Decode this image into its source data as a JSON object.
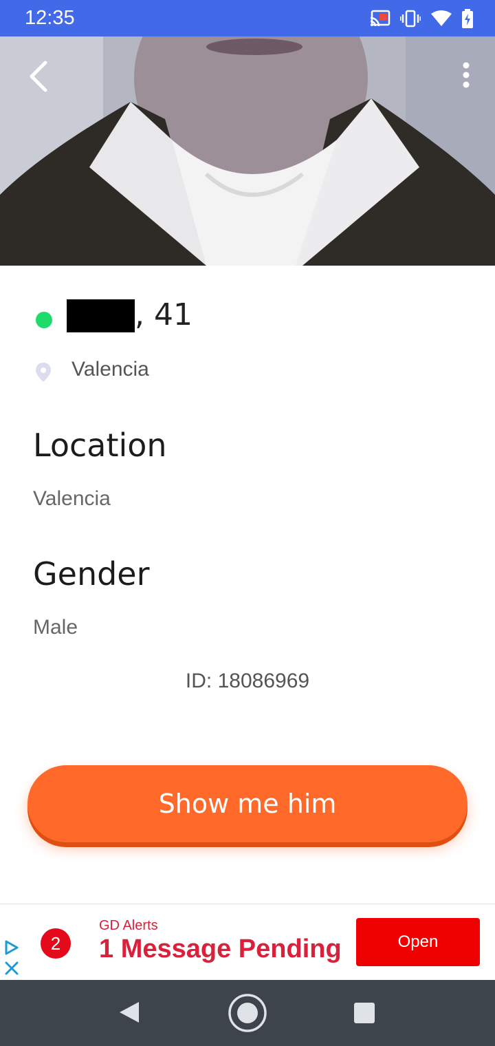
{
  "status_bar": {
    "time": "12:35",
    "icons": [
      "cast-icon",
      "vibrate-icon",
      "wifi-icon",
      "battery-charging-icon"
    ],
    "background": "#4169E8"
  },
  "profile": {
    "online": true,
    "name_redacted": true,
    "age_suffix": ", 41",
    "city": "Valencia"
  },
  "sections": [
    {
      "title": "Location",
      "value": "Valencia"
    },
    {
      "title": "Gender",
      "value": "Male"
    }
  ],
  "user_id": "ID: 18086969",
  "cta": {
    "label": "Show me him",
    "color": "#ff6a2a"
  },
  "ad": {
    "badge_count": "2",
    "source": "GD Alerts",
    "headline": "1 Message Pending",
    "button_label": "Open"
  },
  "nav_bar": {
    "icons": [
      "back-triangle-icon",
      "home-circle-icon",
      "recents-square-icon"
    ]
  }
}
